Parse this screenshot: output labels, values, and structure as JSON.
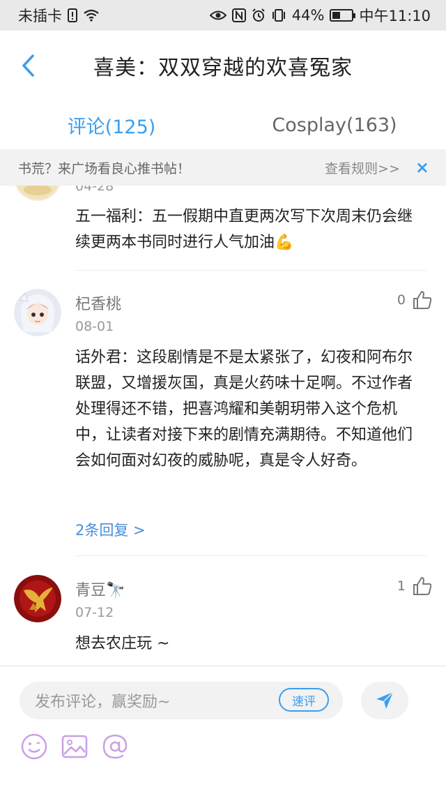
{
  "status_bar": {
    "carrier": "未插卡",
    "battery": "44%",
    "battery_level": 0.44,
    "time": "中午11:10"
  },
  "header": {
    "title": "喜美：双双穿越的欢喜冤家"
  },
  "tabs": [
    {
      "label": "评论(125)",
      "active": true
    },
    {
      "label": "Cosplay(163)",
      "active": false
    }
  ],
  "notice": {
    "text": "书荒？来广场看良心推书帖！",
    "link": "查看规则>>",
    "close": "×"
  },
  "comments": [
    {
      "date": "04-28",
      "text": "五一福利：五一假期中直更两次写下次周末仍会继续更两本书同时进行人气加油💪"
    },
    {
      "name": "杞香桃",
      "date": "08-01",
      "likes": "0",
      "text": "话外君：这段剧情是不是太紧张了，幻夜和阿布尔联盟，又增援灰国，真是火药味十足啊。不过作者处理得还不错，把喜鸿耀和美朝玥带入这个危机中，让读者对接下来的剧情充满期待。不知道他们会如何面对幻夜的威胁呢，真是令人好奇。",
      "replies": "2条回复 >"
    },
    {
      "name": "青豆🔭",
      "date": "07-12",
      "likes": "1",
      "text": "想去农庄玩 ~"
    }
  ],
  "composer": {
    "placeholder": "发布评论，赢奖励~",
    "speed_label": "速评"
  },
  "colors": {
    "accent": "#3a9ef0",
    "reply_link": "#4a8fd8",
    "emoji_tool": "#c9a0e6"
  }
}
